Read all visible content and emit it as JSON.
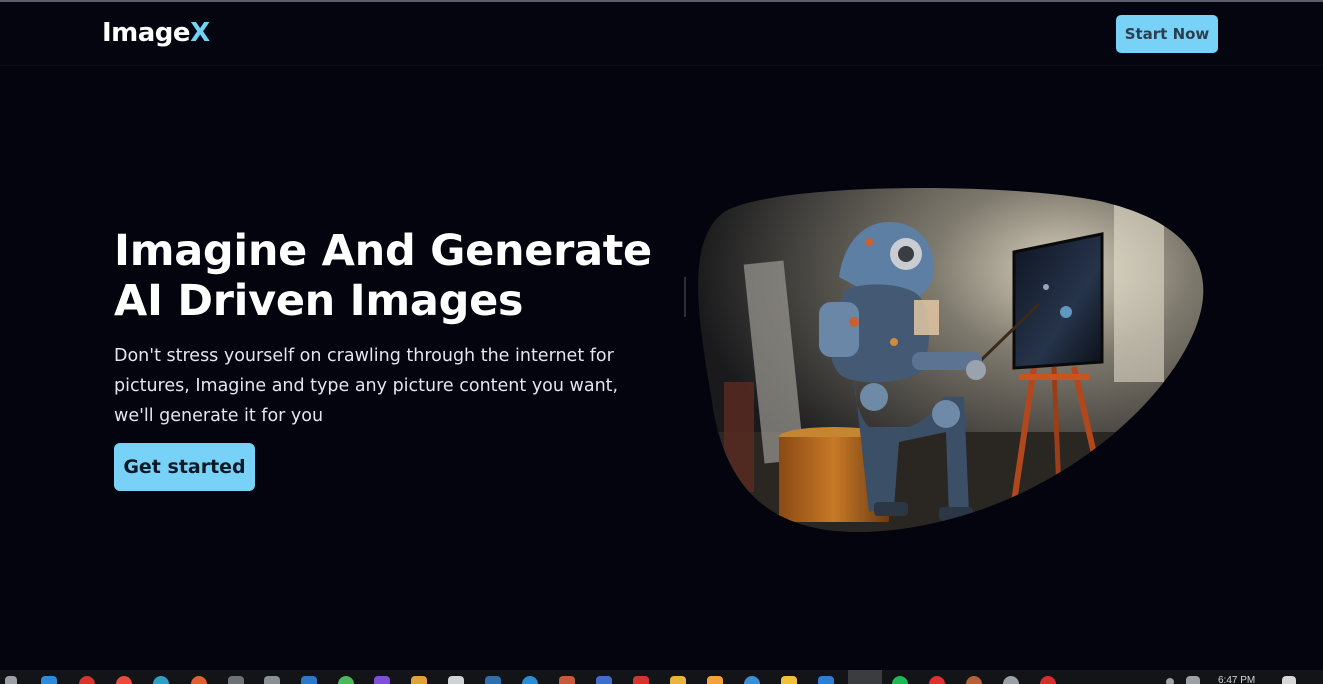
{
  "navbar": {
    "logo_main": "Image",
    "logo_accent": "X",
    "cta_label": "Start Now"
  },
  "hero": {
    "title_line1": "Imagine And Generate",
    "title_line2": "AI Driven Images",
    "description": "Don't stress yourself on crawling through the internet for pictures, Imagine and type any picture content you want, we'll generate it for you",
    "cta_label": "Get started",
    "image_icon": "robot-painter-illustration"
  },
  "taskbar": {
    "time": "6:47 PM"
  },
  "colors": {
    "background": "#03040d",
    "accent": "#78d2f7",
    "logo_accent": "#6fd3f5",
    "text": "#ffffff"
  }
}
